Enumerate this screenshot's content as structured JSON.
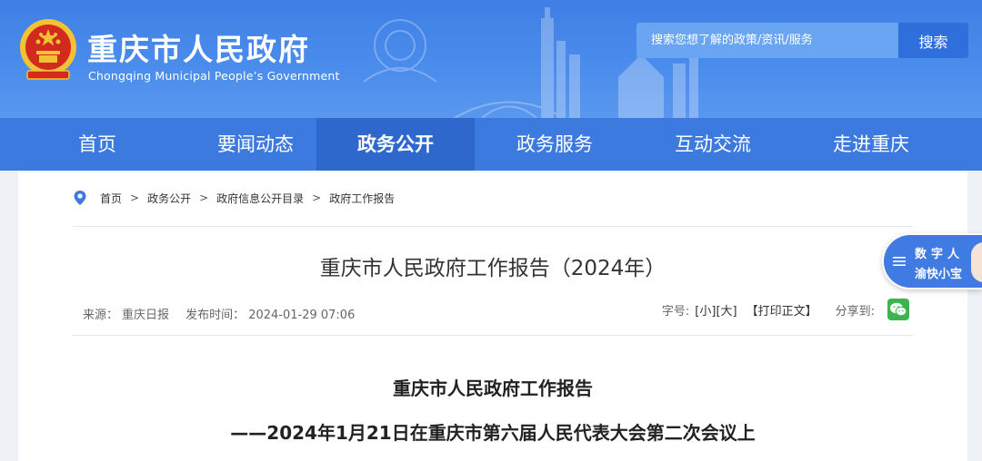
{
  "header": {
    "title": "重庆市人民政府",
    "subtitle": "Chongqing Municipal People’s Government",
    "search": {
      "placeholder": "搜索您想了解的政策/资讯/服务",
      "button_label": "搜索"
    }
  },
  "nav": {
    "items": [
      {
        "label": "首页"
      },
      {
        "label": "要闻动态"
      },
      {
        "label": "政务公开",
        "active": true
      },
      {
        "label": "政务服务"
      },
      {
        "label": "互动交流"
      },
      {
        "label": "走进重庆"
      }
    ]
  },
  "breadcrumb": {
    "items": [
      "首页",
      "政务公开",
      "政府信息公开目录",
      "政府工作报告"
    ],
    "separator": ">"
  },
  "article": {
    "title": "重庆市人民政府工作报告（2024年）",
    "meta": {
      "source_label": "来源：",
      "source": "重庆日报",
      "publish_label": "发布时间：",
      "publish_time": "2024-01-29 07:06",
      "font_size_label": "字号:",
      "font_small": "[小]",
      "font_large": "[大]",
      "print_label": "【打印正文】",
      "share_label": "分享到:"
    },
    "heading": "重庆市人民政府工作报告",
    "subheading": "——2024年1月21日在重庆市第六届人民代表大会第二次会议上"
  },
  "assistant": {
    "line1": "数字人",
    "line2": "渝快小宝"
  },
  "colors": {
    "header_blue": "#4a8cec",
    "nav_blue": "#3d7ae0",
    "nav_active": "#2e68cc",
    "search_button": "#2f6fdc",
    "wechat_green": "#3fb34f"
  }
}
